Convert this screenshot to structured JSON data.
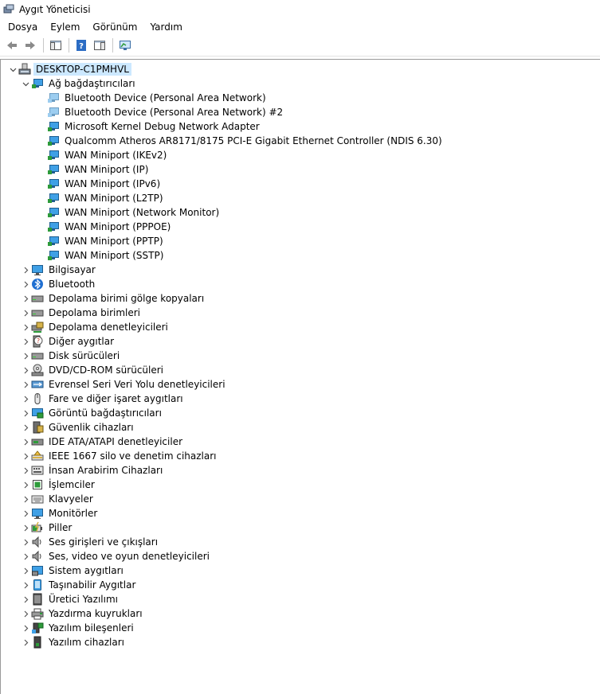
{
  "window": {
    "title": "Aygıt Yöneticisi"
  },
  "menu": {
    "items": [
      "Dosya",
      "Eylem",
      "Görünüm",
      "Yardım"
    ]
  },
  "tree": {
    "root": "DESKTOP-C1PMHVL",
    "network_category": "Ağ bağdaştırıcıları",
    "network_adapters": [
      "Bluetooth Device (Personal Area Network)",
      "Bluetooth Device (Personal Area Network) #2",
      "Microsoft Kernel Debug Network Adapter",
      "Qualcomm Atheros AR8171/8175 PCI-E Gigabit Ethernet Controller (NDIS 6.30)",
      "WAN Miniport (IKEv2)",
      "WAN Miniport (IP)",
      "WAN Miniport (IPv6)",
      "WAN Miniport (L2TP)",
      "WAN Miniport (Network Monitor)",
      "WAN Miniport (PPPOE)",
      "WAN Miniport (PPTP)",
      "WAN Miniport (SSTP)"
    ],
    "categories": [
      "Bilgisayar",
      "Bluetooth",
      "Depolama birimi gölge kopyaları",
      "Depolama birimleri",
      "Depolama denetleyicileri",
      "Diğer aygıtlar",
      "Disk sürücüleri",
      "DVD/CD-ROM sürücüleri",
      "Evrensel Seri Veri Yolu denetleyicileri",
      "Fare ve diğer işaret aygıtları",
      "Görüntü bağdaştırıcıları",
      "Güvenlik cihazları",
      "IDE ATA/ATAPI denetleyiciler",
      "IEEE 1667 silo ve denetim cihazları",
      "İnsan Arabirim Cihazları",
      "İşlemciler",
      "Klavyeler",
      "Monitörler",
      "Piller",
      "Ses girişleri ve çıkışları",
      "Ses, video ve oyun denetleyicileri",
      "Sistem aygıtları",
      "Taşınabilir Aygıtlar",
      "Üretici Yazılımı",
      "Yazdırma kuyrukları",
      "Yazılım bileşenleri",
      "Yazılım cihazları"
    ],
    "category_icons": [
      "monitor-icon",
      "bluetooth-icon",
      "drive-icon",
      "drive-icon",
      "storage-controller-icon",
      "unknown-device-icon",
      "drive-icon",
      "dvd-icon",
      "usb-icon",
      "mouse-icon",
      "display-adapter-icon",
      "security-icon",
      "ide-icon",
      "ieee-icon",
      "hid-icon",
      "processor-icon",
      "keyboard-icon",
      "monitor-icon",
      "battery-icon",
      "speaker-icon",
      "speaker-icon",
      "system-icon",
      "portable-icon",
      "firmware-icon",
      "printer-icon",
      "software-component-icon",
      "software-device-icon"
    ]
  },
  "colors": {
    "selected_bg": "#cce8ff",
    "accent": "#0078d7",
    "network_green": "#2d9b3a"
  }
}
